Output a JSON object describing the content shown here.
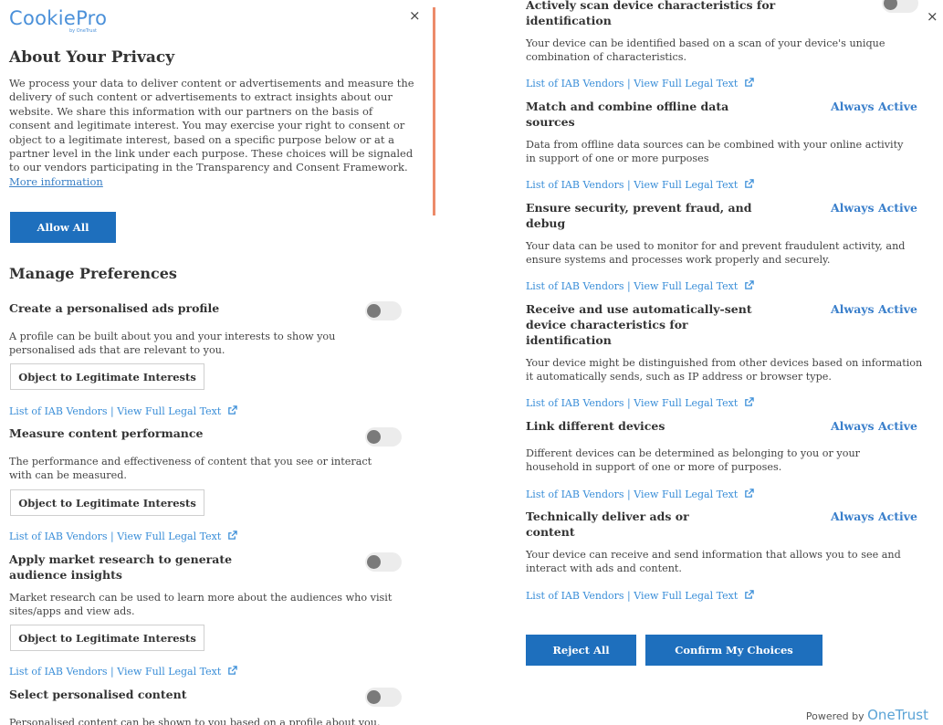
{
  "left": {
    "logo": "CookiePro",
    "logo_sub": "by OneTrust",
    "close": "×",
    "about_title": "About Your Privacy",
    "about_text": "We process your data to deliver content or advertisements and measure the delivery of such content or advertisements to extract insights about our website. We share this information with our partners on the basis of consent and legitimate interest. You may exercise your right to consent or object to a legitimate interest, based on a specific purpose below or at a partner level in the link under each purpose. These choices will be signaled to our vendors participating in the Transparency and Consent Framework.",
    "more_info": "More information",
    "allow_all": "Allow All",
    "manage_title": "Manage Preferences",
    "prefs": [
      {
        "title": "Create a personalised ads profile",
        "desc": "A profile can be built about you and your interests to show you personalised ads that are relevant to you.",
        "object_btn": "Object to Legitimate Interests",
        "vendors": "List of IAB Vendors",
        "sep": "|",
        "legal": "View Full Legal Text"
      },
      {
        "title": "Measure content performance",
        "desc": "The performance and effectiveness of content that you see or interact with can be measured.",
        "object_btn": "Object to Legitimate Interests",
        "vendors": "List of IAB Vendors",
        "sep": "|",
        "legal": "View Full Legal Text"
      },
      {
        "title": "Apply market research to generate audience insights",
        "desc": "Market research can be used to learn more about the audiences who visit sites/apps and view ads.",
        "object_btn": "Object to Legitimate Interests",
        "vendors": "List of IAB Vendors",
        "sep": "|",
        "legal": "View Full Legal Text"
      },
      {
        "title": "Select personalised content",
        "desc": "Personalised content can be shown to you based on a profile about you."
      }
    ]
  },
  "right": {
    "close": "×",
    "top_partial_title": "Actively scan device characteristics for identification",
    "top_partial_desc": "Your device can be identified based on a scan of your device's unique combination of characteristics.",
    "sections": [
      {
        "title": "Match and combine offline data sources",
        "status": "Always Active",
        "desc": "Data from offline data sources can be combined with your online activity in support of one or more purposes"
      },
      {
        "title": "Ensure security, prevent fraud, and debug",
        "status": "Always Active",
        "desc": "Your data can be used to monitor for and prevent fraudulent activity, and ensure systems and processes work properly and securely."
      },
      {
        "title": "Receive and use automatically-sent device characteristics for identification",
        "status": "Always Active",
        "desc": "Your device might be distinguished from other devices based on information it automatically sends, such as IP address or browser type."
      },
      {
        "title": "Link different devices",
        "status": "Always Active",
        "desc": "Different devices can be determined as belonging to you or your household in support of one or more of purposes."
      },
      {
        "title": "Technically deliver ads or content",
        "status": "Always Active",
        "desc": "Your device can receive and send information that allows you to see and interact with ads and content."
      }
    ],
    "vendors": "List of IAB Vendors",
    "sep": "|",
    "legal": "View Full Legal Text",
    "reject_all": "Reject All",
    "confirm": "Confirm My Choices",
    "powered_by": "Powered by",
    "powered_brand": "OneTrust"
  },
  "colors": {
    "primary": "#1e6fbd",
    "link": "#3a8ed8",
    "always_active": "#3a7fcb",
    "divider": "#ec8b6a"
  }
}
